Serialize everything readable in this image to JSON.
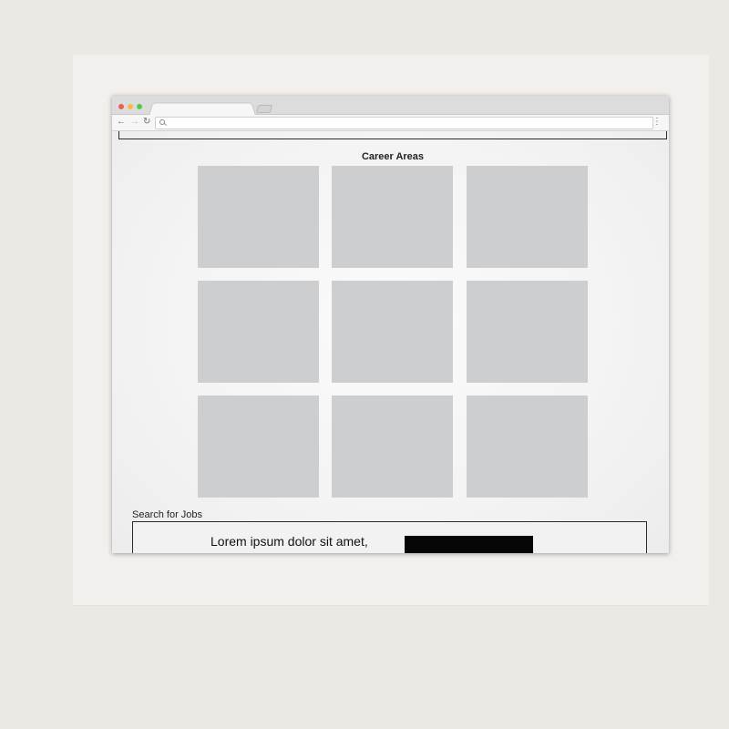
{
  "browser": {
    "menu_glyph": "⋮",
    "nav": {
      "back_glyph": "←",
      "forward_glyph": "→",
      "reload_glyph": "↻"
    }
  },
  "page": {
    "career_section": {
      "title": "Career Areas",
      "tiles": [
        "",
        "",
        "",
        "",
        "",
        "",
        "",
        "",
        ""
      ]
    },
    "search_section": {
      "label": "Search for Jobs",
      "text": "Lorem ipsum dolor sit amet,"
    }
  },
  "colors": {
    "tile": "#cdcecf",
    "page_bg": "#f1f1f1",
    "border": "#2a2a2a",
    "black_field": "#050505"
  },
  "icons": [
    "search-icon",
    "back-arrow-icon",
    "forward-arrow-icon",
    "reload-icon",
    "menu-dots-icon"
  ]
}
